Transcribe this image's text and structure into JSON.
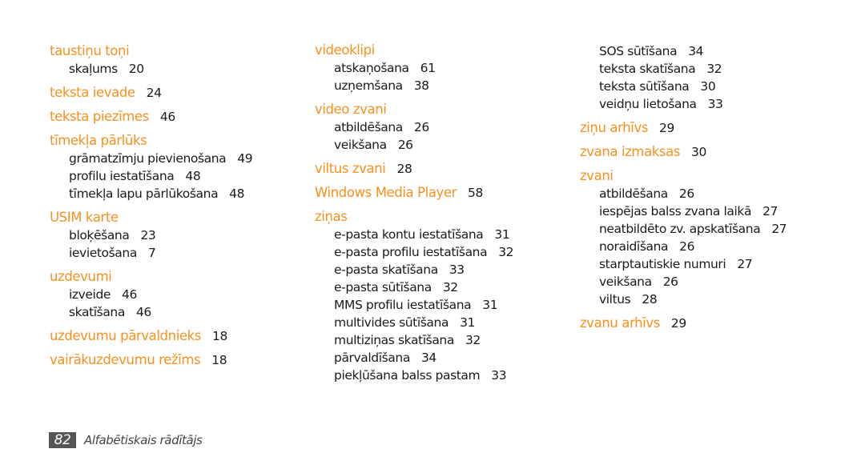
{
  "accent_color": "#f7901e",
  "columns": [
    {
      "entries": [
        {
          "type": "head",
          "text": "taustiņu toņi",
          "page": ""
        },
        {
          "type": "sub",
          "text": "skaļums",
          "page": "20"
        },
        {
          "type": "head",
          "text": "teksta ievade",
          "page": "24"
        },
        {
          "type": "head",
          "text": "teksta piezīmes",
          "page": "46"
        },
        {
          "type": "head",
          "text": "tīmekļa pārlūks",
          "page": ""
        },
        {
          "type": "sub",
          "text": "grāmatzīmju pievienošana",
          "page": "49"
        },
        {
          "type": "sub",
          "text": "profilu iestatīšana",
          "page": "48"
        },
        {
          "type": "sub",
          "text": "tīmekļa lapu pārlūkošana",
          "page": "48"
        },
        {
          "type": "head",
          "text": "USIM karte",
          "page": ""
        },
        {
          "type": "sub",
          "text": "bloķēšana",
          "page": "23"
        },
        {
          "type": "sub",
          "text": "ievietošana",
          "page": "7"
        },
        {
          "type": "head",
          "text": "uzdevumi",
          "page": ""
        },
        {
          "type": "sub",
          "text": "izveide",
          "page": "46"
        },
        {
          "type": "sub",
          "text": "skatīšana",
          "page": "46"
        },
        {
          "type": "head",
          "text": "uzdevumu pārvaldnieks",
          "page": "18"
        },
        {
          "type": "head",
          "text": "vairākuzdevumu režīms",
          "page": "18"
        }
      ]
    },
    {
      "entries": [
        {
          "type": "head",
          "text": "videoklipi",
          "page": ""
        },
        {
          "type": "sub",
          "text": "atskaņošana",
          "page": "61"
        },
        {
          "type": "sub",
          "text": "uzņemšana",
          "page": "38"
        },
        {
          "type": "head",
          "text": "video zvani",
          "page": ""
        },
        {
          "type": "sub",
          "text": "atbildēšana",
          "page": "26"
        },
        {
          "type": "sub",
          "text": "veikšana",
          "page": "26"
        },
        {
          "type": "head",
          "text": "viltus zvani",
          "page": "28"
        },
        {
          "type": "head",
          "text": "Windows Media Player",
          "page": "58"
        },
        {
          "type": "head",
          "text": "ziņas",
          "page": ""
        },
        {
          "type": "sub",
          "text": "e-pasta kontu iestatīšana",
          "page": "31"
        },
        {
          "type": "sub",
          "text": "e-pasta profilu iestatīšana",
          "page": "32"
        },
        {
          "type": "sub",
          "text": "e-pasta skatīšana",
          "page": "33"
        },
        {
          "type": "sub",
          "text": "e-pasta sūtīšana",
          "page": "32"
        },
        {
          "type": "sub",
          "text": "MMS profilu iestatīšana",
          "page": "31"
        },
        {
          "type": "sub",
          "text": "multivides sūtīšana",
          "page": "31"
        },
        {
          "type": "sub",
          "text": "multiziņas skatīšana",
          "page": "32"
        },
        {
          "type": "sub",
          "text": "pārvaldīšana",
          "page": "34"
        },
        {
          "type": "sub",
          "text": "piekļūšana balss pastam",
          "page": "33"
        }
      ]
    },
    {
      "entries": [
        {
          "type": "sub",
          "text": "SOS sūtīšana",
          "page": "34"
        },
        {
          "type": "sub",
          "text": "teksta skatīšana",
          "page": "32"
        },
        {
          "type": "sub",
          "text": "teksta sūtīšana",
          "page": "30"
        },
        {
          "type": "sub",
          "text": "veidņu lietošana",
          "page": "33"
        },
        {
          "type": "head",
          "text": "ziņu arhīvs",
          "page": "29"
        },
        {
          "type": "head",
          "text": "zvana izmaksas",
          "page": "30"
        },
        {
          "type": "head",
          "text": "zvani",
          "page": ""
        },
        {
          "type": "sub",
          "text": "atbildēšana",
          "page": "26"
        },
        {
          "type": "sub",
          "text": "iespējas balss zvana laikā",
          "page": "27"
        },
        {
          "type": "sub",
          "text": "neatbildēto zv. apskatīšana",
          "page": "27"
        },
        {
          "type": "sub",
          "text": "noraidīšana",
          "page": "26"
        },
        {
          "type": "sub",
          "text": "starptautiskie numuri",
          "page": "27"
        },
        {
          "type": "sub",
          "text": "veikšana",
          "page": "26"
        },
        {
          "type": "sub",
          "text": "viltus",
          "page": "28"
        },
        {
          "type": "head",
          "text": "zvanu arhīvs",
          "page": "29"
        }
      ]
    }
  ],
  "footer": {
    "page_number": "82",
    "section_title": "Alfabētiskais rādītājs"
  }
}
